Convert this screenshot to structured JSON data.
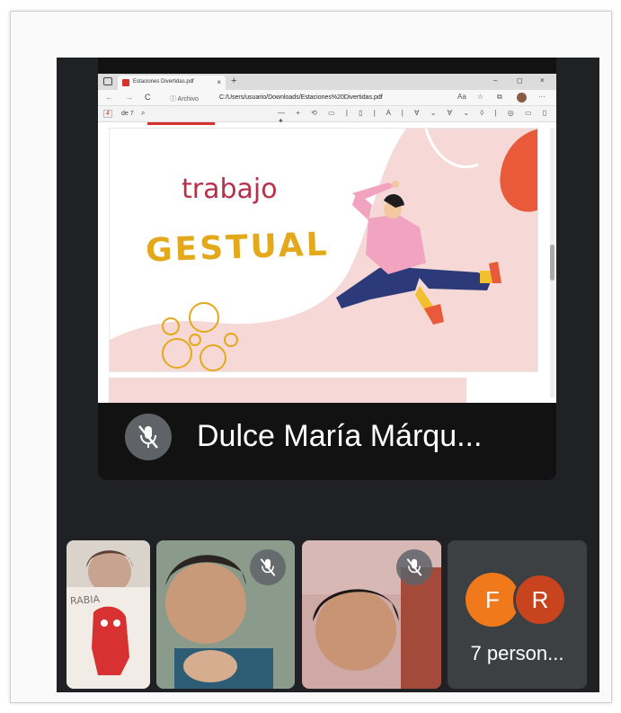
{
  "browser": {
    "tab_title": "Estaciones Divertidas.pdf",
    "tab_close": "×",
    "new_tab": "+",
    "window_controls": [
      "–",
      "◻",
      "×"
    ],
    "nav_back": "←",
    "nav_forward": "→",
    "nav_refresh": "C",
    "site_info": "ⓘ Archivo",
    "url": "C:/Users/usuario/Downloads/Estaciones%20Divertidas.pdf"
  },
  "pdf_toolbar": {
    "page_number": "4",
    "page_total": "de 7",
    "search_icon": "search-icon",
    "tools": "— + ⟲ ▭ | ▯ | A | ∀ ⌄ ∀ ⌄ ◊ | ◎ ▭ ▯ ✦"
  },
  "slide": {
    "title_line1": "trabajo",
    "title_line2": "GESTUAL",
    "colors": {
      "background": "#f6d8d7",
      "trabajo": "#b8314b",
      "gestual": "#e4a91b",
      "accent_red": "#e85a3a"
    }
  },
  "presenter": {
    "name": "Dulce María Márqu...",
    "mic": "mic-off-icon"
  },
  "participants": {
    "tile1_sign": "RABIA",
    "avatars": [
      {
        "letter": "F",
        "color": "#f07a1b"
      },
      {
        "letter": "R",
        "color": "#c8441f"
      }
    ],
    "others_label": "7 person..."
  }
}
